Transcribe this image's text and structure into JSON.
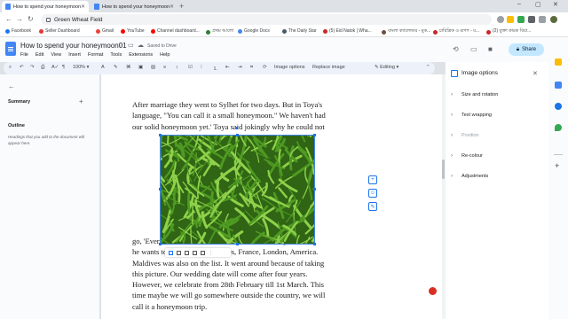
{
  "browser": {
    "tabs": [
      {
        "label": "How to spend your honeymoon01",
        "active": true
      },
      {
        "label": "How to spend your honeymoon01",
        "active": false
      }
    ],
    "new_tab": "+",
    "window_controls": {
      "minimize": "–",
      "maximize": "▢",
      "close": "✕"
    },
    "address": "Green Wheat Field"
  },
  "bookmarks": [
    {
      "label": "Facebook",
      "color": "#1877f2"
    },
    {
      "label": "Seller Dashboard",
      "color": "#e53935"
    },
    {
      "label": "Gmail",
      "color": "#ea4335"
    },
    {
      "label": "YouTube",
      "color": "#ff0000"
    },
    {
      "label": "Channel dashboard...",
      "color": "#ff0000"
    },
    {
      "label": "প্রথম আলো",
      "color": "#2e7d32"
    },
    {
      "label": "Google Docs",
      "color": "#4285f4"
    },
    {
      "label": "The Daily Star",
      "color": "#455a64"
    },
    {
      "label": "(5) Eid Natok | Wha...",
      "color": "#c62828"
    },
    {
      "label": "বাংলা ক্যালেন্ডার - মুক...",
      "color": "#6d4c41"
    },
    {
      "label": "চারিত্রিক ও রূপগ - য...",
      "color": "#c62828"
    },
    {
      "label": "(2) যুক্তা কারক বিয়া...",
      "color": "#c62828"
    }
  ],
  "doc": {
    "title": "How to spend your honeymoon01",
    "saved_status": "Saved to Drive",
    "menus": [
      "File",
      "Edit",
      "View",
      "Insert",
      "Format",
      "Tools",
      "Extensions",
      "Help"
    ],
    "share_label": "Share"
  },
  "toolbar": {
    "zoom": "100%",
    "image_options": "Image options",
    "replace_image": "Replace image",
    "mode": "Editing"
  },
  "outline_panel": {
    "summary_label": "Summary",
    "add": "+",
    "outline_label": "Outline",
    "outline_note": "Headings that you add to the document will appear here."
  },
  "document_text": {
    "para1": [
      "After marriage they went to Sylhet for two days. But in Toya's",
      "language, \"You can call it a small honeymoon.\" We haven't had",
      "our solid honeymoon yet.' Toya said jokingly why he could not"
    ],
    "para2": [
      "go, 'Every time ..................................................... y time",
      "he wants to go ......................... es, France, London, America.",
      "Maldives was also on the list. It went around because of taking",
      "this picture. Our wedding date will come after four years.",
      "However, we celebrate from 28th February till 1st March. This",
      "time maybe we will go somewhere outside the country, we will",
      "call it a honeymoon trip."
    ]
  },
  "image": {
    "alt": "Green Wheat Field",
    "colors": {
      "dark": "#2f6514",
      "mid": "#4f9a22",
      "light": "#8fd14a"
    }
  },
  "image_options_panel": {
    "title": "Image options",
    "close": "✕",
    "sections": [
      {
        "label": "Size and rotation",
        "disabled": false
      },
      {
        "label": "Text wrapping",
        "disabled": false
      },
      {
        "label": "Position",
        "disabled": true
      },
      {
        "label": "Re-colour",
        "disabled": false
      },
      {
        "label": "Adjustments",
        "disabled": false
      }
    ]
  },
  "colors": {
    "accent": "#1a73e8",
    "share_bg": "#c2e7ff",
    "toolbar_bg": "#edf2fa"
  }
}
